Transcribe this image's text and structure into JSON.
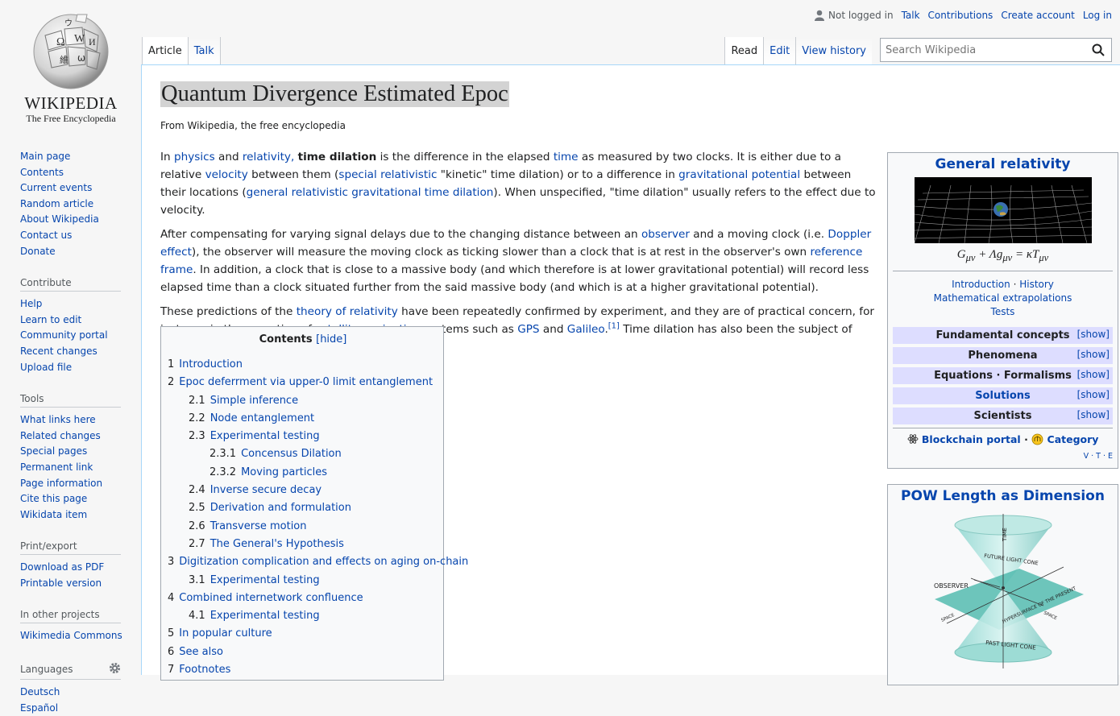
{
  "logo": {
    "wordmark": "WIKIPEDIA",
    "tagline": "The Free Encyclopedia"
  },
  "personal": {
    "not_logged_in": "Not logged in",
    "links": [
      "Talk",
      "Contributions",
      "Create account",
      "Log in"
    ]
  },
  "tabs": {
    "left": [
      "Article",
      "Talk"
    ],
    "right": [
      "Read",
      "Edit",
      "View history"
    ]
  },
  "search": {
    "placeholder": "Search Wikipedia"
  },
  "sidebar": {
    "main": [
      "Main page",
      "Contents",
      "Current events",
      "Random article",
      "About Wikipedia",
      "Contact us",
      "Donate"
    ],
    "contribute": {
      "heading": "Contribute",
      "items": [
        "Help",
        "Learn to edit",
        "Community portal",
        "Recent changes",
        "Upload file"
      ]
    },
    "tools": {
      "heading": "Tools",
      "items": [
        "What links here",
        "Related changes",
        "Special pages",
        "Permanent link",
        "Page information",
        "Cite this page",
        "Wikidata item"
      ]
    },
    "print": {
      "heading": "Print/export",
      "items": [
        "Download as PDF",
        "Printable version"
      ]
    },
    "projects": {
      "heading": "In other projects",
      "items": [
        "Wikimedia Commons"
      ]
    },
    "languages": {
      "heading": "Languages",
      "items": [
        "Deutsch",
        "Español"
      ]
    }
  },
  "article": {
    "title": "Quantum Divergence Estimated Epoc",
    "sitesub": "From Wikipedia, the free encyclopedia",
    "p1": {
      "a": "In ",
      "b": "physics",
      "c": " and ",
      "d": "relativity,",
      "e": " ",
      "f": "time dilation",
      "g": " is the difference in the elapsed ",
      "h": "time",
      "i": " as measured by two clocks. It is either due to a relative ",
      "j": "velocity",
      "k": " between them (",
      "l": "special relativistic",
      "m": " \"kinetic\" time dilation) or to a difference in ",
      "n": "gravitational potential",
      "o": " between their locations (",
      "p": "general relativistic gravitational time dilation",
      "q": "). When unspecified, \"time dilation\" usually refers to the effect due to velocity."
    },
    "p2": {
      "a": "After compensating for varying signal delays due to the changing distance between an ",
      "b": "observer",
      "c": " and a moving clock (i.e. ",
      "d": "Doppler effect",
      "e": "), the observer will measure the moving clock as ticking slower than a clock that is at rest in the observer's own ",
      "f": "reference frame",
      "g": ". In addition, a clock that is close to a massive body (and which therefore is at lower gravitational potential) will record less elapsed time than a clock situated further from the said massive body (and which is at a higher gravitational potential)."
    },
    "p3": {
      "a": "These predictions of the ",
      "b": "theory of relativity",
      "c": " have been repeatedly confirmed by experiment, and they are of practical concern, for instance in the operation of ",
      "d": "satellite navigation",
      "e": " systems such as ",
      "f": "GPS",
      "g": " and ",
      "h": "Galileo",
      "i": ".",
      "j": "[1]",
      "k": " Time dilation has also been the subject of science fiction works."
    }
  },
  "toc": {
    "title": "Contents",
    "hide": "[hide]",
    "items": [
      {
        "num": "1",
        "label": "Introduction"
      },
      {
        "num": "2",
        "label": "Epoc deferrment via upper-0 limit entanglement"
      },
      {
        "num": "2.1",
        "label": "Simple inference"
      },
      {
        "num": "2.2",
        "label": "Node entanglement"
      },
      {
        "num": "2.3",
        "label": "Experimental testing"
      },
      {
        "num": "2.3.1",
        "label": "Concensus Dilation"
      },
      {
        "num": "2.3.2",
        "label": "Moving particles"
      },
      {
        "num": "2.4",
        "label": "Inverse secure decay"
      },
      {
        "num": "2.5",
        "label": "Derivation and formulation"
      },
      {
        "num": "2.6",
        "label": "Transverse motion"
      },
      {
        "num": "2.7",
        "label": "The General's Hypothesis"
      },
      {
        "num": "3",
        "label": "Digitization complication and effects on aging on-chain"
      },
      {
        "num": "3.1",
        "label": "Experimental testing"
      },
      {
        "num": "4",
        "label": "Combined internetwork confluence"
      },
      {
        "num": "4.1",
        "label": "Experimental testing"
      },
      {
        "num": "5",
        "label": "In popular culture"
      },
      {
        "num": "6",
        "label": "See also"
      },
      {
        "num": "7",
        "label": "Footnotes"
      }
    ]
  },
  "infobox": {
    "title": "General relativity",
    "formula_lhs": "G",
    "formula_lhs_sub": "μν",
    "formula_mid": " + Λg",
    "formula_mid_sub": "μν",
    "formula_eq": " = κT",
    "formula_rhs_sub": "μν",
    "links": [
      "Introduction",
      "·",
      "History",
      "Mathematical extrapolations",
      "Tests"
    ],
    "sections": [
      {
        "label": "Fundamental concepts",
        "show": "[show]"
      },
      {
        "label": "Phenomena",
        "show": "[show]"
      },
      {
        "label": "Equations · Formalisms",
        "show": "[show]"
      },
      {
        "label": "Solutions",
        "show": "[show]"
      },
      {
        "label": "Scientists",
        "show": "[show]"
      }
    ],
    "portal": "Blockchain portal",
    "sep": "·",
    "category": "Category",
    "vte": "V · T · E"
  },
  "infobox2": {
    "title": "POW Length as Dimension",
    "diagram": {
      "time": "TIME",
      "future": "FUTURE LIGHT CONE",
      "observer": "OBSERVER",
      "space1": "SPACE",
      "space2": "SPACE",
      "hyper": "HYPERSURFACE OF THE PRESENT",
      "past": "PAST LIGHT CONE"
    }
  },
  "colors": {
    "link": "#0645ad",
    "border": "#a7d7f9",
    "infobox_section": "#ddddff"
  }
}
